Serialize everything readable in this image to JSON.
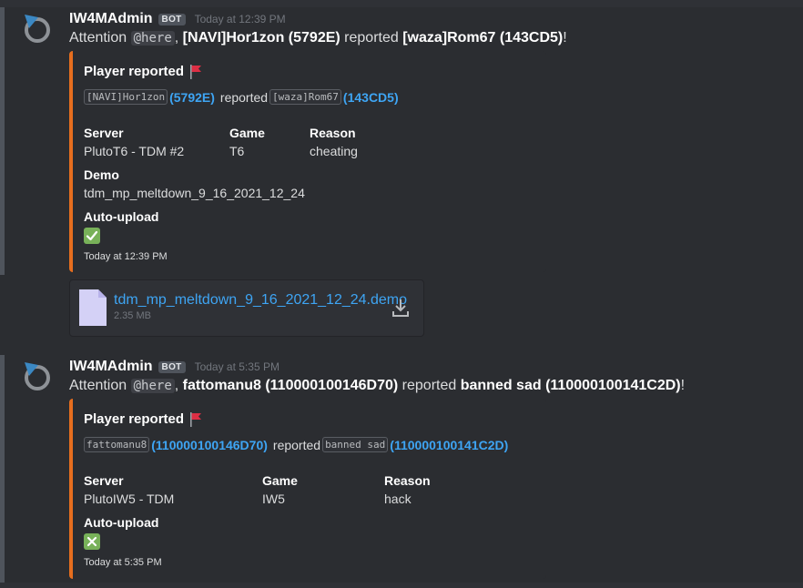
{
  "messages": [
    {
      "author": "IW4MAdmin",
      "bot_tag": "BOT",
      "timestamp": "Today at 12:39 PM",
      "content": {
        "prefix": "Attention ",
        "mention": "@here",
        "comma": ", ",
        "reporter": "[NAVI]Hor1zon (5792E)",
        "verb": " reported ",
        "reported": "[waza]Rom67 (143CD5)",
        "suffix": "!"
      },
      "embed": {
        "accent_color": "#e66e1e",
        "title": "Player reported",
        "title_icon": "red-flag-icon",
        "description": {
          "reporter_name": "[NAVI]Hor1zon",
          "reporter_id": "(5792E)",
          "verb": "reported",
          "reported_name": "[waza]Rom67",
          "reported_id": "(143CD5)"
        },
        "fields": [
          {
            "name": "Server",
            "value": "PlutoT6 - TDM #2"
          },
          {
            "name": "Game",
            "value": "T6"
          },
          {
            "name": "Reason",
            "value": "cheating"
          },
          {
            "name": "Demo",
            "value": "tdm_mp_meltdown_9_16_2021_12_24"
          },
          {
            "name": "Auto-upload",
            "value_icon": "check-mark-icon"
          }
        ],
        "footer": "Today at 12:39 PM"
      },
      "attachment": {
        "filename": "tdm_mp_meltdown_9_16_2021_12_24.demo",
        "size": "2.35 MB",
        "icon": "file-icon",
        "action_icon": "download-icon"
      }
    },
    {
      "author": "IW4MAdmin",
      "bot_tag": "BOT",
      "timestamp": "Today at 5:35 PM",
      "content": {
        "prefix": "Attention ",
        "mention": "@here",
        "comma": ", ",
        "reporter": "fattomanu8 (110000100146D70)",
        "verb": " reported ",
        "reported": "banned sad (110000100141C2D)",
        "suffix": "!"
      },
      "embed": {
        "accent_color": "#e66e1e",
        "title": "Player reported",
        "title_icon": "red-flag-icon",
        "description": {
          "reporter_name": "fattomanu8",
          "reporter_id": "(110000100146D70)",
          "verb": "reported",
          "reported_name": "banned sad",
          "reported_id": "(110000100141C2D)"
        },
        "fields": [
          {
            "name": "Server",
            "value": "PlutoIW5 - TDM"
          },
          {
            "name": "Game",
            "value": "IW5"
          },
          {
            "name": "Reason",
            "value": "hack"
          },
          {
            "name": "Auto-upload",
            "value_icon": "cross-mark-icon"
          }
        ],
        "footer": "Today at 5:35 PM"
      }
    }
  ]
}
